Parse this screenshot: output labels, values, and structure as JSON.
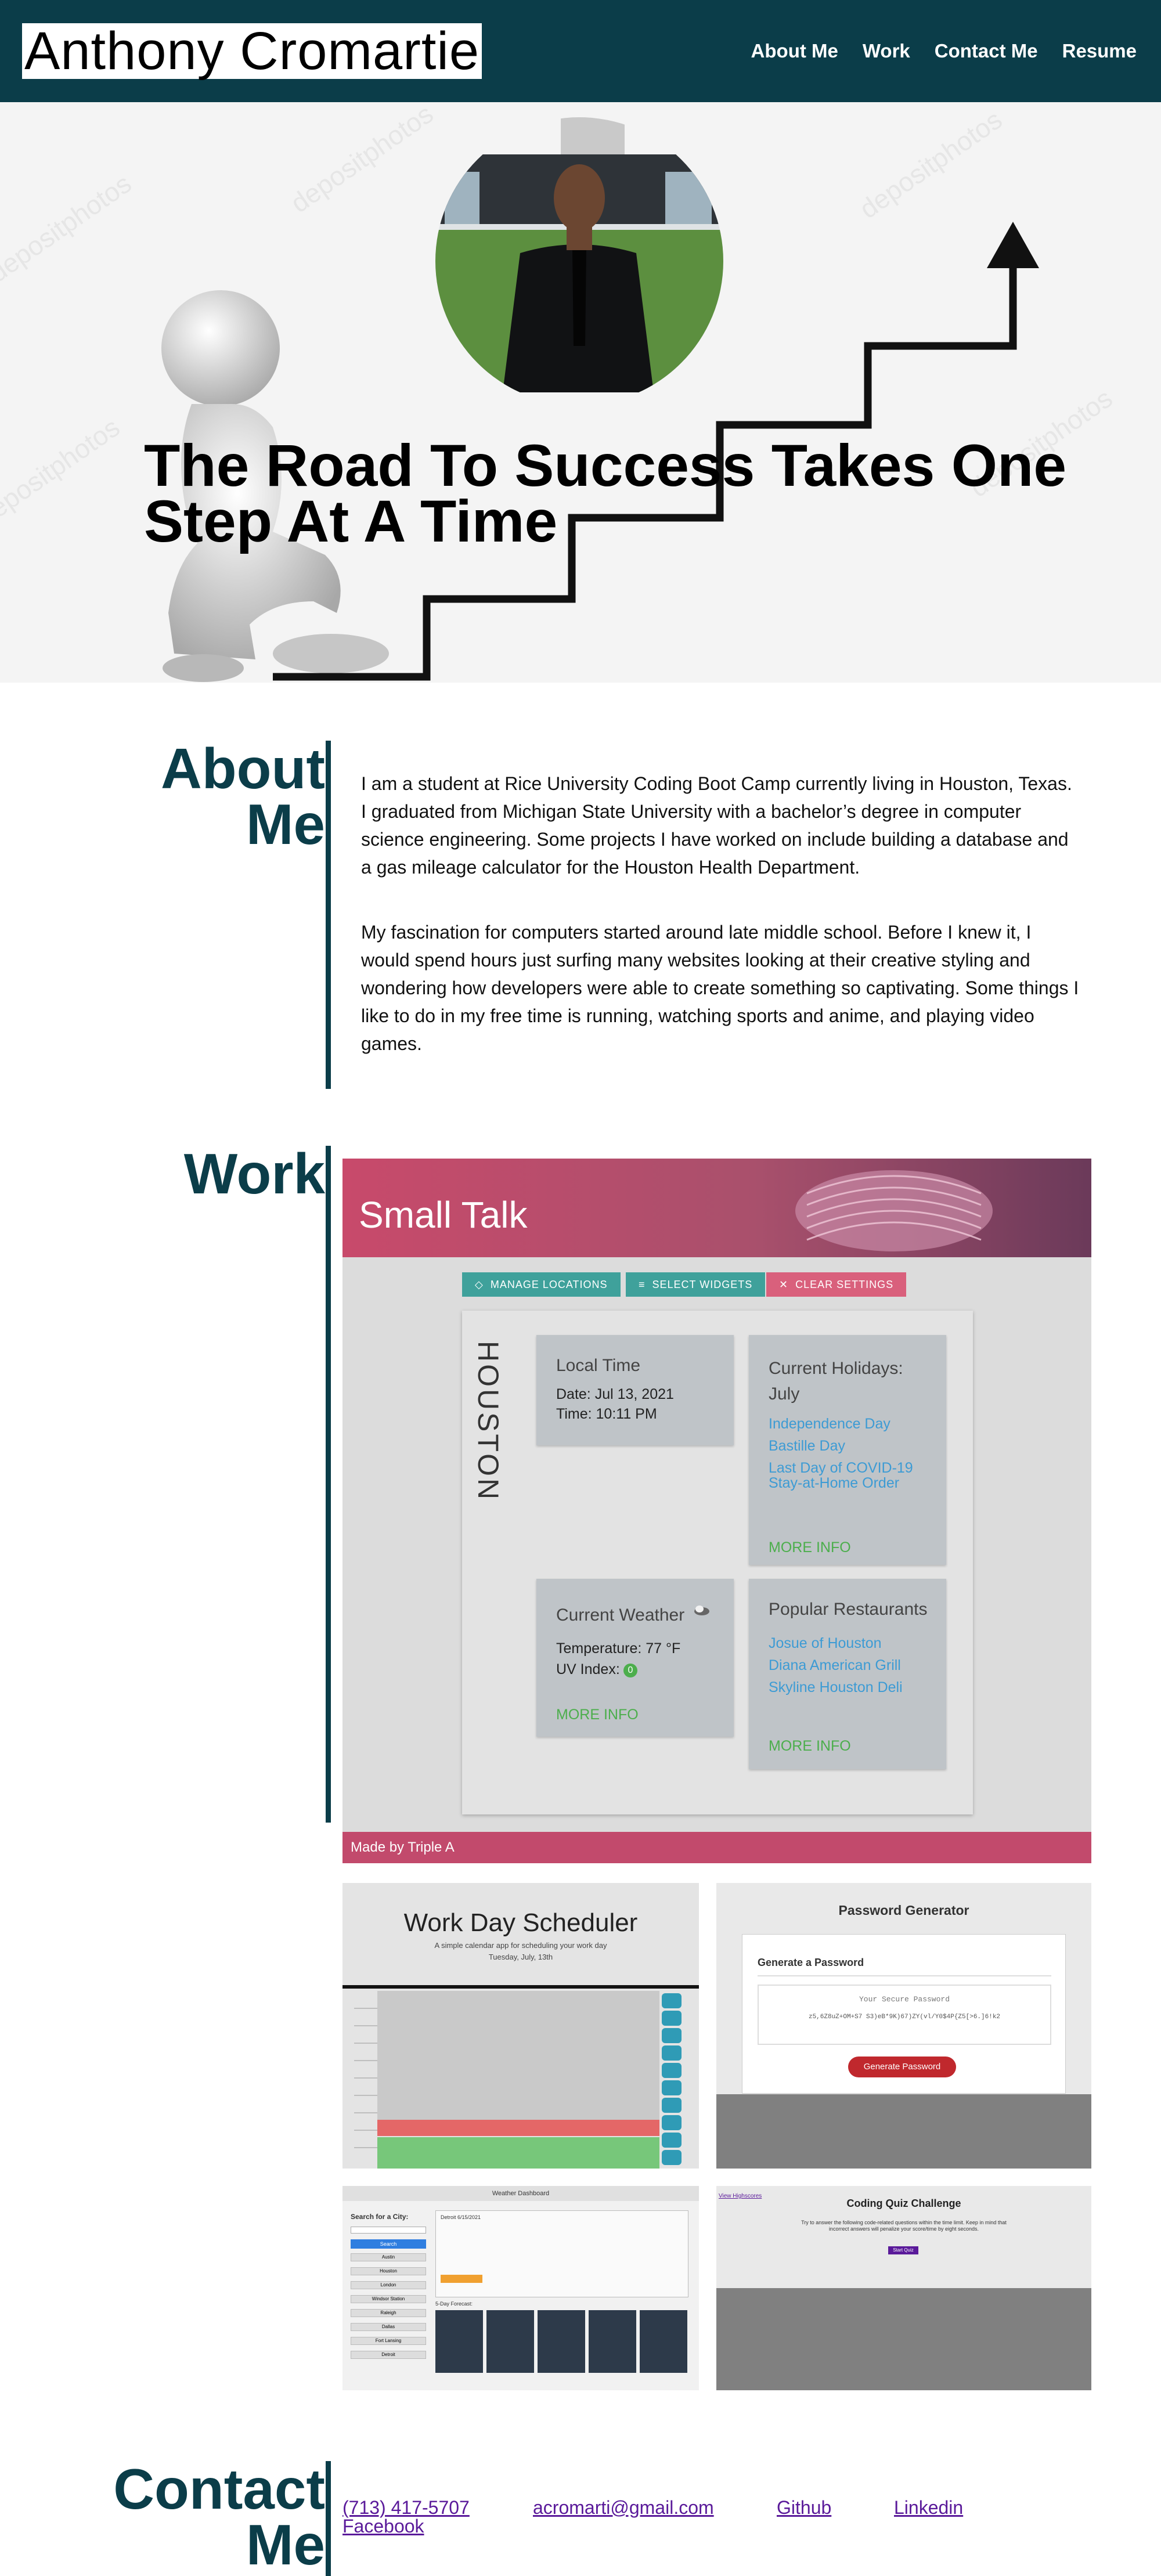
{
  "header": {
    "brand": "Anthony Cromartie",
    "nav": [
      "About Me",
      "Work",
      "Contact Me",
      "Resume"
    ]
  },
  "hero": {
    "title": "The Road To Success Takes One Step At A Time",
    "watermark": "depositphotos"
  },
  "about": {
    "title": "About Me",
    "paragraphs": [
      "I am a student at Rice University Coding Boot Camp currently living in Houston, Texas. I graduated from Michigan State University with a bachelor’s degree in computer science engineering. Some projects I have worked on include building a database and a gas mileage calculator for the Houston Health Department.",
      "My fascination for computers started around late middle school. Before I knew it, I would spend hours just surfing many websites looking at their creative styling and wondering how developers were able to create something so captivating. Some things I like to do in my free time is running, watching sports and anime, and playing video games."
    ]
  },
  "work": {
    "title": "Work",
    "small_talk": {
      "title": "Small Talk",
      "buttons": [
        "MANAGE LOCATIONS",
        "SELECT WIDGETS",
        "CLEAR SETTINGS"
      ],
      "city": "HOUSTON",
      "local_time": {
        "heading": "Local Time",
        "date": "Date: Jul 13, 2021",
        "time": "Time: 10:11 PM"
      },
      "holidays": {
        "heading": "Current Holidays: July",
        "items": [
          "Independence Day",
          "Bastille Day",
          "Last Day of COVID-19 Stay-at-Home Order"
        ],
        "more": "MORE INFO"
      },
      "weather": {
        "heading": "Current Weather",
        "temp": "Temperature: 77 °F",
        "uv": "UV Index:",
        "uv_value": "0",
        "more": "MORE INFO"
      },
      "restaurants": {
        "heading": "Popular Restaurants",
        "items": [
          "Josue of Houston",
          "Diana American Grill",
          "Skyline Houston Deli"
        ],
        "more": "MORE INFO"
      },
      "footer": "Made by Triple A"
    },
    "scheduler": {
      "title": "Work Day Scheduler",
      "subtitle": "A simple calendar app for scheduling your work day",
      "date": "Tuesday, July, 13th"
    },
    "password": {
      "title": "Password Generator",
      "card_title": "Generate a Password",
      "field_label": "Your Secure Password",
      "field_value": "z5,6Z8uZ+OM+S7 S3)eB*9K)67)ZY(vl/Y0$4P{Z5[>6.]6!k2",
      "button": "Generate Password"
    },
    "weather_dash": {
      "header": "Weather Dashboard",
      "search_label": "Search for a City:",
      "search_button": "Search",
      "cities": [
        "Austin",
        "Houston",
        "London",
        "Windsor Station",
        "Raleigh",
        "Dallas",
        "Fort Lansing",
        "Detroit"
      ],
      "current": "Detroit 6/15/2021",
      "forecast_label": "5-Day Forecast:"
    },
    "quiz": {
      "link": "View Highscores",
      "title": "Coding Quiz Challenge",
      "text": "Try to answer the following code-related questions within the time limit. Keep in mind that incorrect answers will penalize your score/time by eight seconds.",
      "button": "Start Quiz"
    }
  },
  "contact": {
    "title": "Contact Me",
    "phone": "(713) 417-5707",
    "email": "acromarti@gmail.com",
    "github": "Github",
    "linkedin": "Linkedin",
    "facebook": "Facebook"
  }
}
